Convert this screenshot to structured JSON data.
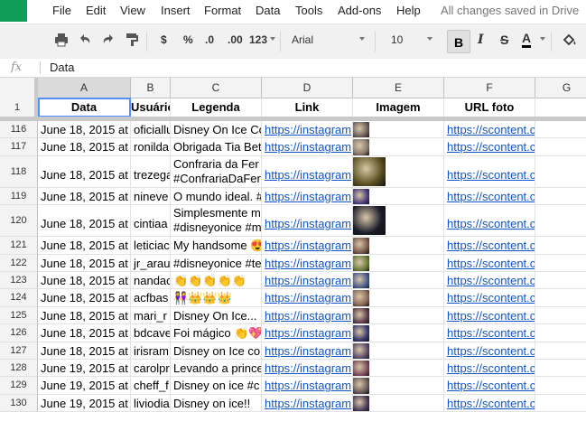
{
  "menu": {
    "items": [
      "File",
      "Edit",
      "View",
      "Insert",
      "Format",
      "Data",
      "Tools",
      "Add-ons",
      "Help"
    ],
    "status": "All changes saved in Drive"
  },
  "toolbar": {
    "currency": "$",
    "percent": "%",
    "dec_less": ".0",
    "dec_more": ".00",
    "more_formats": "123",
    "font": "Arial",
    "size": "10",
    "bold": "B",
    "italic": "I",
    "strike": "S",
    "text_color": "A"
  },
  "formula_bar": {
    "fx": "fx",
    "value": "Data"
  },
  "columns": [
    "A",
    "B",
    "C",
    "D",
    "E",
    "F",
    "G"
  ],
  "headers": [
    "Data",
    "Usuário",
    "Legenda",
    "Link",
    "Imagem",
    "URL foto"
  ],
  "first_row_num": "1",
  "rows": [
    {
      "num": "116",
      "data": "June 18, 2015 at",
      "user": "oficiallu",
      "legenda": [
        "Disney On Ice Co"
      ],
      "link": "https://instagram",
      "url": "https://scontent.cdninstagra",
      "thumb": "#6b5b5b"
    },
    {
      "num": "117",
      "data": "June 18, 2015 at",
      "user": "ronilda",
      "legenda": [
        "Obrigada Tia Bet"
      ],
      "link": "https://instagram",
      "url": "https://scontent.cdninstagra",
      "thumb": "#8a7a6e"
    },
    {
      "num": "118",
      "data": "June 18, 2015 at",
      "user": "trezega",
      "legenda": [
        "Confraria da Fer",
        "#ConfrariaDaFer"
      ],
      "link": "https://instagram",
      "url": "https://scontent.cdninstagra",
      "thumb": "#5a5020"
    },
    {
      "num": "119",
      "data": "June 18, 2015 at",
      "user": "nineve",
      "legenda": [
        "O mundo ideal. #"
      ],
      "link": "https://instagram",
      "url": "https://scontent.cdninstagra",
      "thumb": "#4a3a7a"
    },
    {
      "num": "120",
      "data": "June 18, 2015 at",
      "user": "cintiaa",
      "legenda": [
        "Simplesmente m",
        "#disneyonice #m"
      ],
      "link": "https://instagram",
      "url": "https://scontent.cdninstagra",
      "thumb": "#1a1a2a"
    },
    {
      "num": "121",
      "data": "June 18, 2015 at",
      "user": "leticiac",
      "legenda": [
        "My handsome 😍"
      ],
      "link": "https://instagram",
      "url": "https://scontent.cdninstagra",
      "thumb": "#7a5a4a"
    },
    {
      "num": "122",
      "data": "June 18, 2015 at",
      "user": "jr_arau",
      "legenda": [
        "#disneyonice #te"
      ],
      "link": "https://instagram",
      "url": "https://scontent.cdninstagra",
      "thumb": "#6a7a3a"
    },
    {
      "num": "123",
      "data": "June 18, 2015 at",
      "user": "nandac",
      "legenda": [
        "👏👏👏👏👏"
      ],
      "link": "https://instagram",
      "url": "https://scontent.cdninstagra",
      "thumb": "#4a5a8a"
    },
    {
      "num": "124",
      "data": "June 18, 2015 at",
      "user": "acfbas",
      "legenda": [
        "👭👑👑👑"
      ],
      "link": "https://instagram",
      "url": "https://scontent.cdninstagra",
      "thumb": "#8a6a5a"
    },
    {
      "num": "125",
      "data": "June 18, 2015 at",
      "user": "mari_r",
      "legenda": [
        "Disney On Ice..."
      ],
      "link": "https://instagram",
      "url": "https://scontent.cdninstagra",
      "thumb": "#5a3a4a"
    },
    {
      "num": "126",
      "data": "June 18, 2015 at",
      "user": "bdcave",
      "legenda": [
        "Foi mágico 👏💖"
      ],
      "link": "https://instagram",
      "url": "https://scontent.cdninstagra",
      "thumb": "#3a3a6a"
    },
    {
      "num": "127",
      "data": "June 18, 2015 at",
      "user": "irisram",
      "legenda": [
        "Disney on Ice co"
      ],
      "link": "https://instagram",
      "url": "https://scontent.cdninstagra",
      "thumb": "#5a4a6a"
    },
    {
      "num": "128",
      "data": "June 19, 2015 at",
      "user": "carolpr",
      "legenda": [
        "Levando a prince"
      ],
      "link": "https://instagram",
      "url": "https://scontent.cdninstagra",
      "thumb": "#7a4a5a"
    },
    {
      "num": "129",
      "data": "June 19, 2015 at",
      "user": "cheff_f",
      "legenda": [
        "Disney on ice  #c"
      ],
      "link": "https://instagram",
      "url": "https://scontent.cdninstagra",
      "thumb": "#6a5a5a"
    },
    {
      "num": "130",
      "data": "June 19, 2015 at",
      "user": "liviodia",
      "legenda": [
        "Disney on ice!!"
      ],
      "link": "https://instagram",
      "url": "https://scontent.cdninstagra",
      "thumb": "#4a3a5a"
    }
  ]
}
